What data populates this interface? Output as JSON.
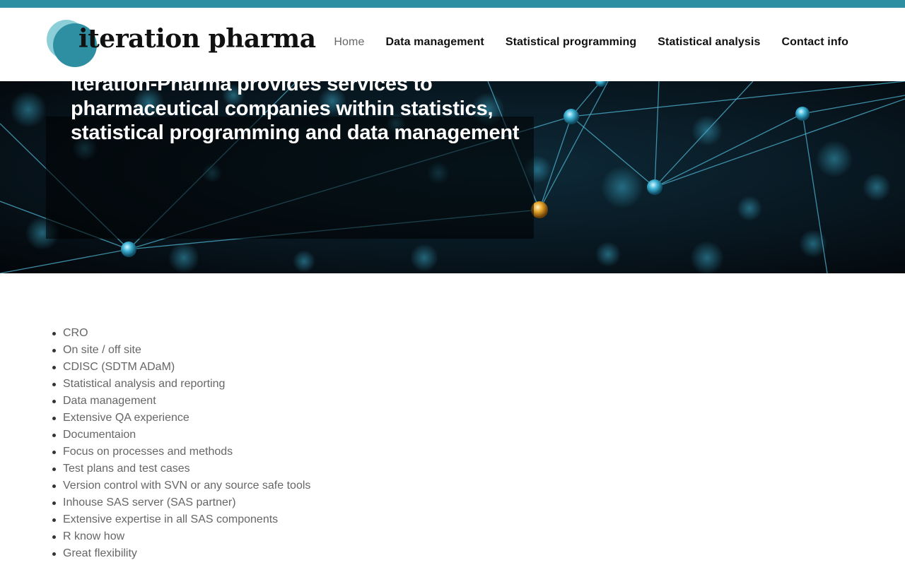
{
  "brand": {
    "name": "iteration pharma",
    "accent_color": "#2e8fa3",
    "logo_icon": "overlapping-circles-logo-icon"
  },
  "nav": {
    "items": [
      {
        "label": "Home",
        "active": true
      },
      {
        "label": "Data management",
        "active": false
      },
      {
        "label": "Statistical programming",
        "active": false
      },
      {
        "label": "Statistical analysis",
        "active": false
      },
      {
        "label": "Contact info",
        "active": false
      }
    ]
  },
  "hero": {
    "headline": "Iteration-Pharma provides services to pharmaceutical companies within statistics, statistical programming and data management",
    "background": "network-nodes-image"
  },
  "features": [
    "CRO",
    "On site / off site",
    "CDISC (SDTM ADaM)",
    "Statistical analysis and reporting",
    "Data management",
    "Extensive QA experience",
    "Documentaion",
    "Focus on processes and methods",
    "Test plans and test cases",
    "Version control with SVN or any source safe tools",
    "Inhouse SAS server (SAS partner)",
    "Extensive expertise in all SAS components",
    "R know how",
    "Great flexibility"
  ]
}
